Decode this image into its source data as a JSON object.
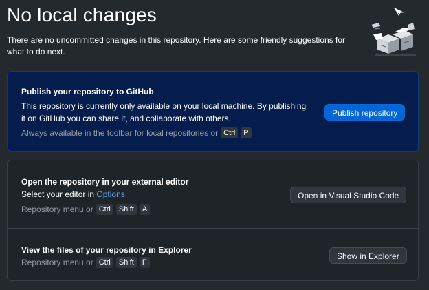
{
  "header": {
    "title": "No local changes",
    "subtitle": "There are no uncommitted changes in this repository. Here are some friendly suggestions for what to do next."
  },
  "publish": {
    "title": "Publish your repository to GitHub",
    "description": "This repository is currently only available on your local machine. By publishing it on GitHub you can share it, and collaborate with others.",
    "hint": "Always available in the toolbar for local repositories or",
    "shortcut": [
      "Ctrl",
      "P"
    ],
    "button_label": "Publish repository"
  },
  "editor": {
    "title": "Open the repository in your external editor",
    "select_prefix": "Select your editor in",
    "options_link": "Options",
    "hint": "Repository menu or",
    "shortcut": [
      "Ctrl",
      "Shift",
      "A"
    ],
    "button_label": "Open in Visual Studio Code"
  },
  "explorer": {
    "title": "View the files of your repository in Explorer",
    "hint": "Repository menu or",
    "shortcut": [
      "Ctrl",
      "Shift",
      "F"
    ],
    "button_label": "Show in Explorer"
  },
  "colors": {
    "background": "#24292e",
    "publish_card": "#051d4d",
    "primary_button": "#0366d6",
    "link": "#58a6ff"
  },
  "icons": {
    "illustration": "empty-boxes-illustration"
  }
}
